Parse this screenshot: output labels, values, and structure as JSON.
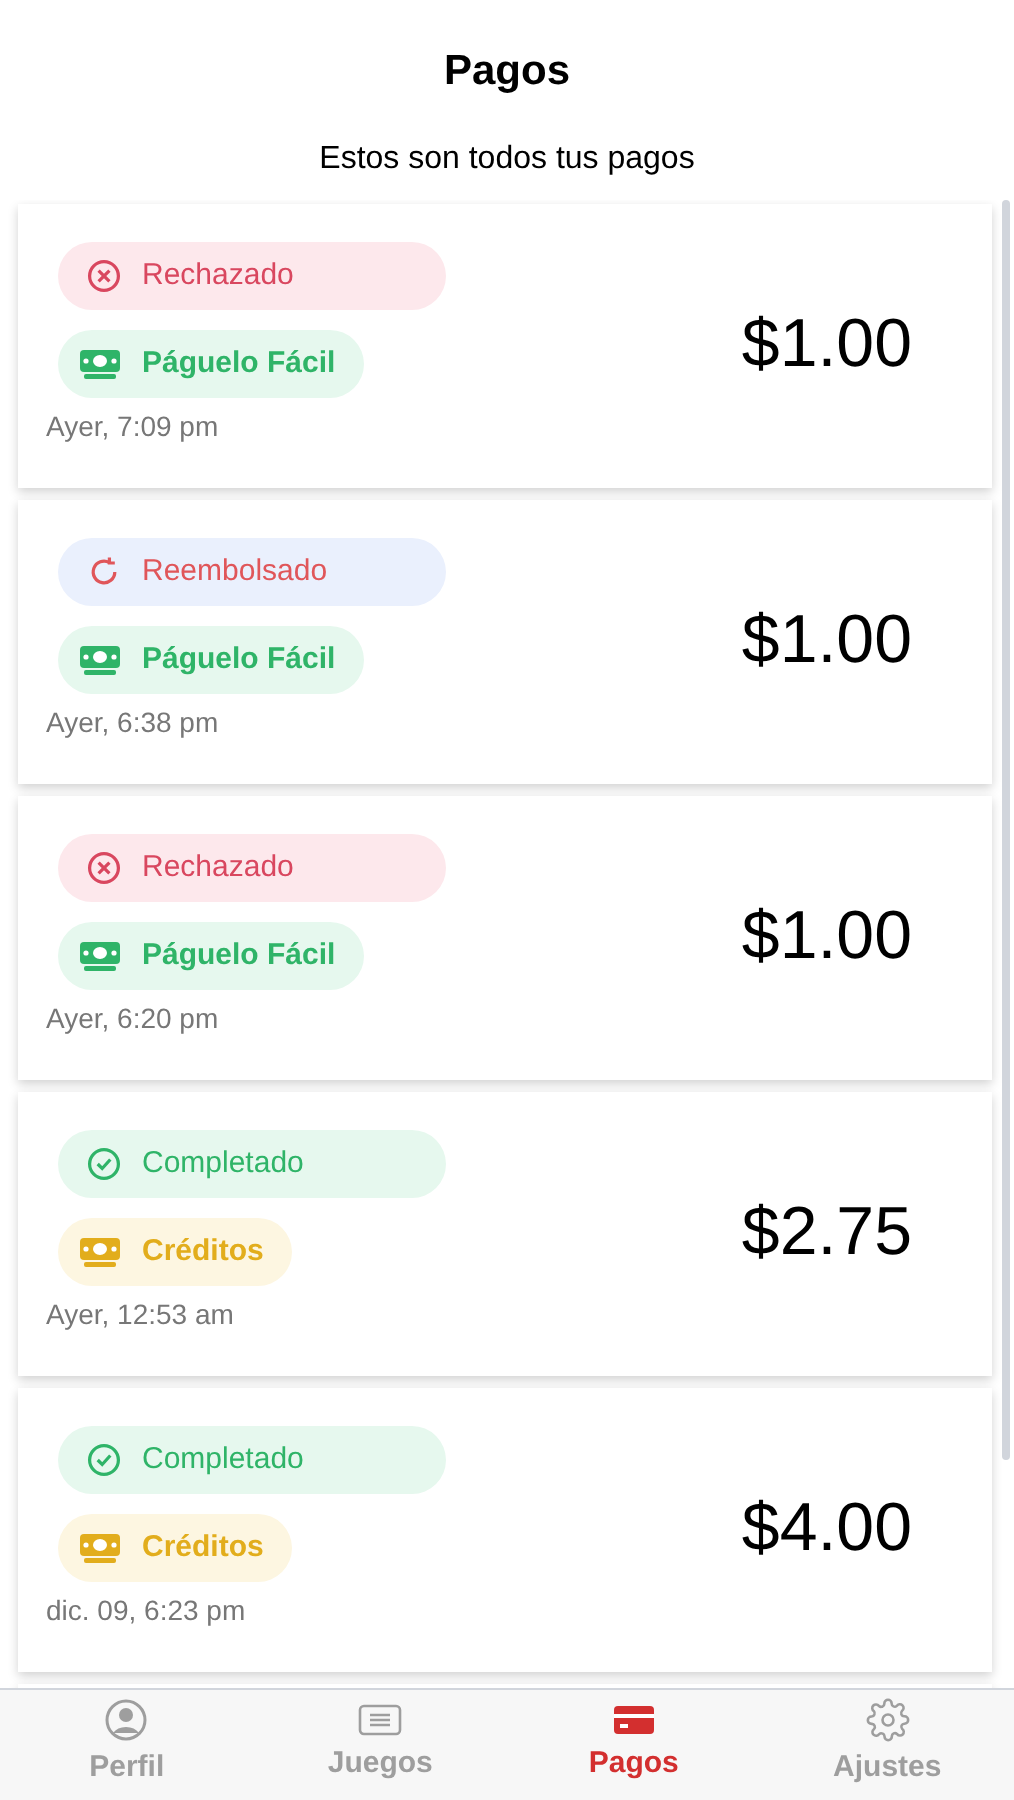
{
  "header": {
    "title": "Pagos",
    "subtitle": "Estos son todos tus pagos"
  },
  "payments": [
    {
      "status": {
        "kind": "rejected",
        "label": "Rechazado"
      },
      "method": {
        "kind": "cash",
        "label": "Páguelo Fácil"
      },
      "date": "Ayer, 7:09 pm",
      "amount": "$1.00"
    },
    {
      "status": {
        "kind": "refunded",
        "label": "Reembolsado"
      },
      "method": {
        "kind": "cash",
        "label": "Páguelo Fácil"
      },
      "date": "Ayer, 6:38 pm",
      "amount": "$1.00"
    },
    {
      "status": {
        "kind": "rejected",
        "label": "Rechazado"
      },
      "method": {
        "kind": "cash",
        "label": "Páguelo Fácil"
      },
      "date": "Ayer, 6:20 pm",
      "amount": "$1.00"
    },
    {
      "status": {
        "kind": "completed",
        "label": "Completado"
      },
      "method": {
        "kind": "credits",
        "label": "Créditos"
      },
      "date": "Ayer, 12:53 am",
      "amount": "$2.75"
    },
    {
      "status": {
        "kind": "completed",
        "label": "Completado"
      },
      "method": {
        "kind": "credits",
        "label": "Créditos"
      },
      "date": "dic. 09, 6:23 pm",
      "amount": "$4.00"
    }
  ],
  "nav": [
    {
      "kind": "profile",
      "label": "Perfil",
      "selected": false
    },
    {
      "kind": "games",
      "label": "Juegos",
      "selected": false
    },
    {
      "kind": "payments",
      "label": "Pagos",
      "selected": true
    },
    {
      "kind": "settings",
      "label": "Ajustes",
      "selected": false
    }
  ]
}
